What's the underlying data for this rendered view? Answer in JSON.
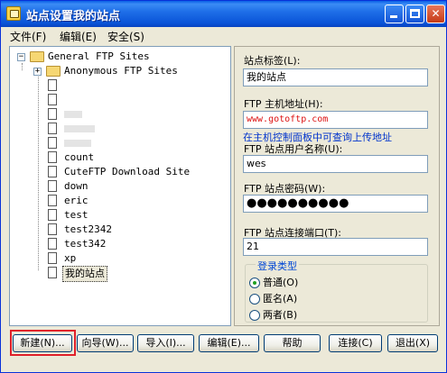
{
  "window": {
    "title": "站点设置我的站点"
  },
  "menu": [
    {
      "label": "文件(F)"
    },
    {
      "label": "编辑(E)"
    },
    {
      "label": "安全(S)"
    }
  ],
  "tree": {
    "root": "General FTP Sites",
    "anonymous": "Anonymous FTP Sites",
    "sites": [
      "count",
      "CuteFTP Download Site",
      "down",
      "eric",
      "test",
      "test2342",
      "test342",
      "xp",
      "我的站点"
    ],
    "selected": "我的站点"
  },
  "form": {
    "label_caption": "站点标签(L):",
    "label_value": "我的站点",
    "host_caption": "FTP 主机地址(H):",
    "host_value": "www.gotoftp.com",
    "host_hint": "在主机控制面板中可查询上传地址",
    "user_caption": "FTP 站点用户名称(U):",
    "user_value": "wes",
    "password_caption": "FTP 站点密码(W):",
    "password_value": "●●●●●●●●●●",
    "port_caption": "FTP 站点连接端口(T):",
    "port_value": "21"
  },
  "login_type": {
    "title": "登录类型",
    "options": [
      {
        "label": "普通(O)",
        "selected": true
      },
      {
        "label": "匿名(A)",
        "selected": false
      },
      {
        "label": "两者(B)",
        "selected": false
      }
    ]
  },
  "buttons": {
    "new": "新建(N)...",
    "wizard": "向导(W)...",
    "import": "导入(I)...",
    "edit": "编辑(E)...",
    "help": "帮助",
    "connect": "连接(C)",
    "exit": "退出(X)"
  },
  "colors": {
    "titlebar": "#0a54d8",
    "highlight": "#e0202a",
    "url_text": "#dd1111",
    "link": "#0033cc"
  }
}
